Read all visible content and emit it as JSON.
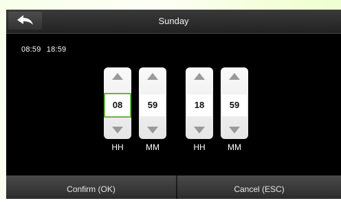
{
  "header": {
    "title": "Sunday",
    "back_icon": "back-arrow-icon"
  },
  "summary": {
    "start": "08:59",
    "end": "18:59"
  },
  "spinners": [
    {
      "value": "08",
      "unit": "HH",
      "selected": true
    },
    {
      "value": "59",
      "unit": "MM",
      "selected": false
    },
    {
      "value": "18",
      "unit": "HH",
      "selected": false
    },
    {
      "value": "59",
      "unit": "MM",
      "selected": false
    }
  ],
  "footer": {
    "confirm_label": "Confirm (OK)",
    "cancel_label": "Cancel (ESC)"
  },
  "colors": {
    "selection_border": "#6ab342",
    "screen_background": "#000000"
  }
}
